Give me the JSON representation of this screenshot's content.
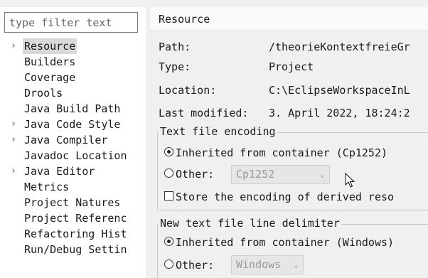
{
  "filter": {
    "placeholder": "type filter text"
  },
  "tree": [
    {
      "label": "Resource",
      "expandable": true,
      "selected": true
    },
    {
      "label": "Builders",
      "expandable": false
    },
    {
      "label": "Coverage",
      "expandable": false
    },
    {
      "label": "Drools",
      "expandable": false
    },
    {
      "label": "Java Build Path",
      "expandable": false
    },
    {
      "label": "Java Code Style",
      "expandable": true
    },
    {
      "label": "Java Compiler",
      "expandable": true
    },
    {
      "label": "Javadoc Location",
      "expandable": false
    },
    {
      "label": "Java Editor",
      "expandable": true
    },
    {
      "label": "Metrics",
      "expandable": false
    },
    {
      "label": "Project Natures",
      "expandable": false
    },
    {
      "label": "Project Referenc",
      "expandable": false
    },
    {
      "label": "Refactoring Hist",
      "expandable": false
    },
    {
      "label": "Run/Debug Settin",
      "expandable": false
    }
  ],
  "page": {
    "title": "Resource",
    "path_label": "Path:",
    "path_value": "/theorieKontextfreieGr",
    "type_label": "Type:",
    "type_value": "Project",
    "location_label": "Location:",
    "location_value": "C:\\EclipseWorkspaceInL",
    "modified_label": "Last modified:",
    "modified_value": "3. April 2022, 18:24:2"
  },
  "encoding": {
    "legend": "Text file encoding",
    "inherited_label": "Inherited from container (Cp1252)",
    "other_label": "Other:",
    "other_value": "Cp1252",
    "store_label": "Store the encoding of derived reso"
  },
  "delimiter": {
    "legend": "New text file line delimiter",
    "inherited_label": "Inherited from container (Windows)",
    "other_label": "Other:",
    "other_value": "Windows"
  }
}
